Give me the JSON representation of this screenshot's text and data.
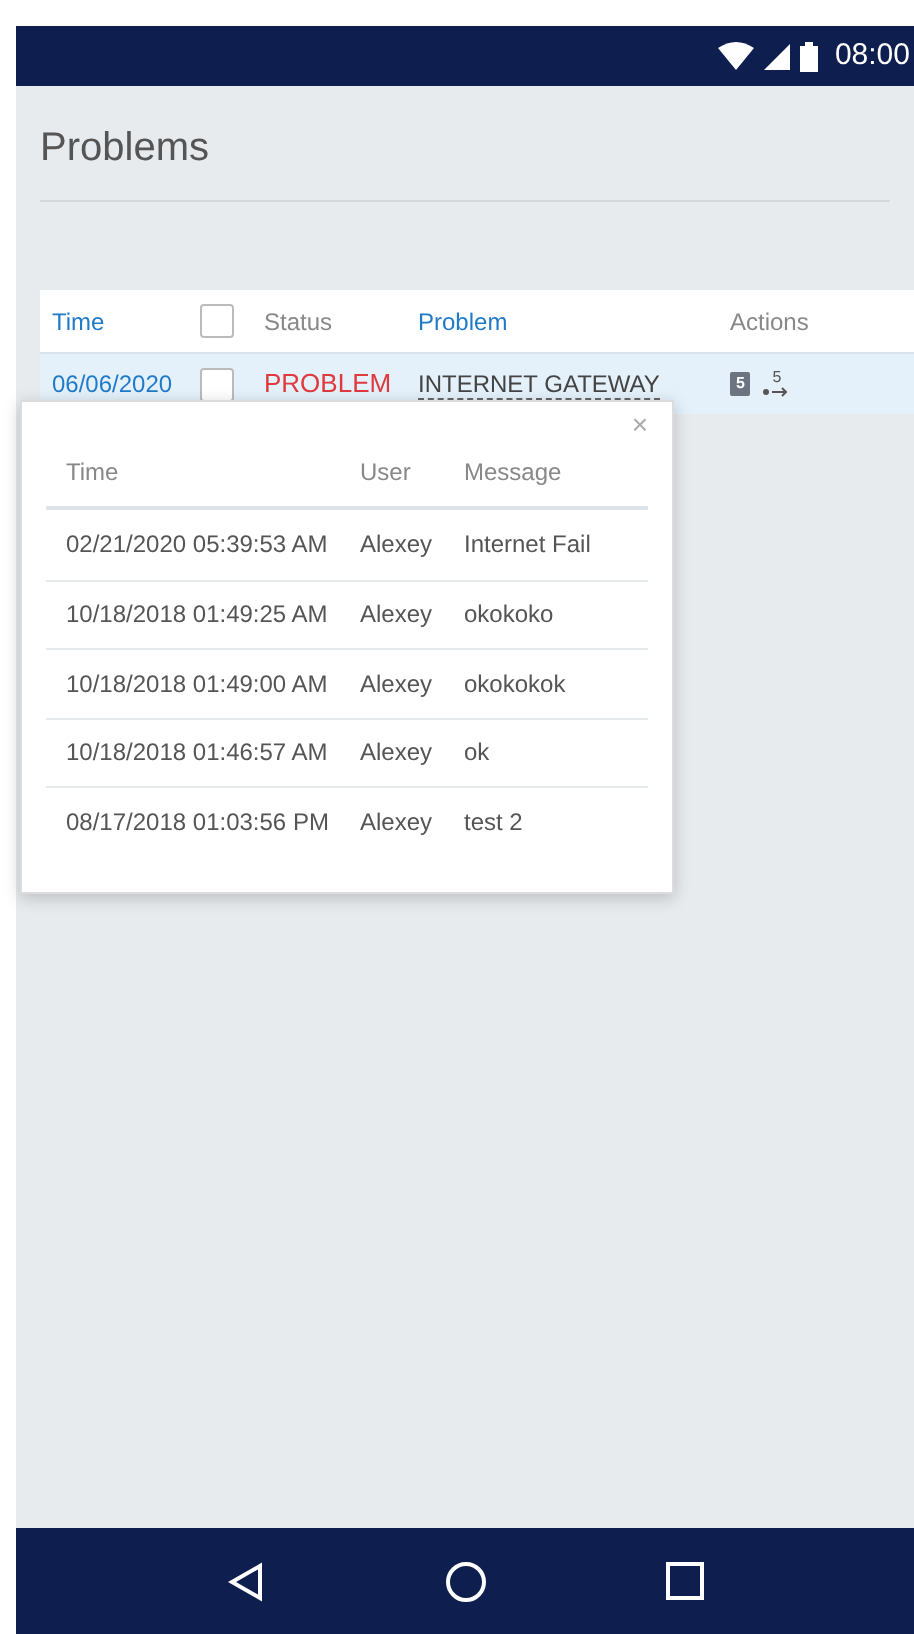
{
  "status_bar": {
    "time": "08:00"
  },
  "page": {
    "title": "Problems"
  },
  "table": {
    "columns": [
      {
        "label": "Time",
        "link": true
      },
      {
        "kind": "checkbox"
      },
      {
        "label": "Status",
        "link": false
      },
      {
        "label": "Problem",
        "link": true
      },
      {
        "label": "Actions",
        "link": false
      }
    ],
    "header_checked": false,
    "rows": [
      {
        "time": "06/06/2020",
        "checked": false,
        "status": "PROBLEM",
        "problem": "INTERNET GATEWAY",
        "messages_count": "5",
        "actions_count": "5"
      }
    ]
  },
  "popup": {
    "columns": [
      "Time",
      "User",
      "Message"
    ],
    "rows": [
      {
        "time": "02/21/2020 05:39:53 AM",
        "user": "Alexey",
        "message": "Internet Fail"
      },
      {
        "time": "10/18/2018 01:49:25 AM",
        "user": "Alexey",
        "message": "okokoko"
      },
      {
        "time": "10/18/2018 01:49:00 AM",
        "user": "Alexey",
        "message": "okokokok"
      },
      {
        "time": "10/18/2018 01:46:57 AM",
        "user": "Alexey",
        "message": "ok"
      },
      {
        "time": "08/17/2018 01:03:56 PM",
        "user": "Alexey",
        "message": "test 2"
      }
    ],
    "close": "×"
  }
}
